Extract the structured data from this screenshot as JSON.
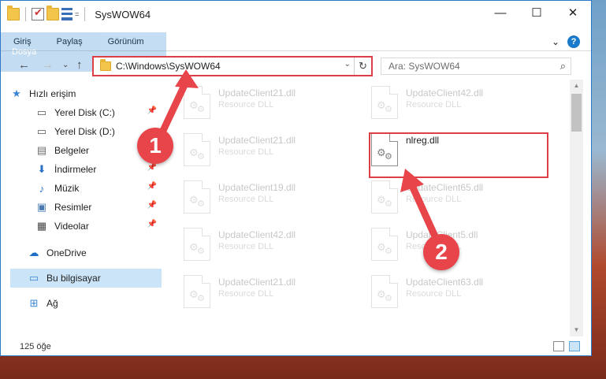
{
  "window": {
    "title": "SysWOW64",
    "qat_more": "=",
    "controls": {
      "minimize": "—",
      "maximize": "☐",
      "close": "✕"
    }
  },
  "ribbon": {
    "tabs": [
      "Dosya",
      "Giriş",
      "Paylaş",
      "Görünüm"
    ],
    "expand_glyph": "⌄",
    "help_glyph": "?"
  },
  "nav": {
    "back": "←",
    "forward": "→",
    "recent": "⌄",
    "up": "↑",
    "address": "C:\\Windows\\SysWOW64",
    "address_dropdown": "⌄",
    "refresh": "↻",
    "search_placeholder": "Ara: SysWOW64",
    "search_glyph": "⌕"
  },
  "sidebar": {
    "items": [
      {
        "label": "Hızlı erişim",
        "icon": "star-icon",
        "glyph": "★",
        "color": "#3a86d4",
        "pinned": false
      },
      {
        "label": "Yerel Disk (C:)",
        "icon": "drive-icon",
        "glyph": "▭",
        "color": "#555555",
        "pinned": true
      },
      {
        "label": "Yerel Disk (D:)",
        "icon": "drive-icon",
        "glyph": "▭",
        "color": "#555555",
        "pinned": false
      },
      {
        "label": "Belgeler",
        "icon": "documents-icon",
        "glyph": "▤",
        "color": "#6d6d6d",
        "pinned": true
      },
      {
        "label": "İndirmeler",
        "icon": "download-icon",
        "glyph": "⬇",
        "color": "#2a6fc4",
        "pinned": true
      },
      {
        "label": "Müzik",
        "icon": "music-icon",
        "glyph": "♪",
        "color": "#2a6fc4",
        "pinned": true
      },
      {
        "label": "Resimler",
        "icon": "pictures-icon",
        "glyph": "▣",
        "color": "#4a7ab0",
        "pinned": true
      },
      {
        "label": "Videolar",
        "icon": "video-icon",
        "glyph": "▦",
        "color": "#444444",
        "pinned": true
      },
      {
        "label": "OneDrive",
        "icon": "cloud-icon",
        "glyph": "☁",
        "color": "#1e6fc4",
        "pinned": false
      },
      {
        "label": "Bu bilgisayar",
        "icon": "computer-icon",
        "glyph": "▭",
        "color": "#3a86d4",
        "pinned": false
      },
      {
        "label": "Ağ",
        "icon": "network-icon",
        "glyph": "⊞",
        "color": "#3a86d4",
        "pinned": false
      }
    ],
    "pin_glyph": "📌"
  },
  "files": [
    {
      "name": "UpdateClient21.dll",
      "type": "Resource DLL"
    },
    {
      "name": "UpdateClient42.dll",
      "type": "Resource DLL"
    },
    {
      "name": "UpdateClient21.dll",
      "type": "Resource DLL"
    },
    {
      "name": "nlreg.dll",
      "type": ""
    },
    {
      "name": "UpdateClient19.dll",
      "type": "Resource DLL"
    },
    {
      "name": "UpdateClient65.dll",
      "type": "Resource DLL"
    },
    {
      "name": "UpdateClient42.dll",
      "type": "Resource DLL"
    },
    {
      "name": "UpdateClient5.dll",
      "type": "Resource DLL"
    },
    {
      "name": "UpdateClient21.dll",
      "type": "Resource DLL"
    },
    {
      "name": "UpdateClient63.dll",
      "type": "Resource DLL"
    }
  ],
  "status": {
    "item_count": "125 öğe"
  },
  "callouts": {
    "first": "1",
    "second": "2"
  },
  "colors": {
    "accent": "#1979ca",
    "highlight_red": "#de3e45",
    "callout_red": "#e8454a"
  }
}
